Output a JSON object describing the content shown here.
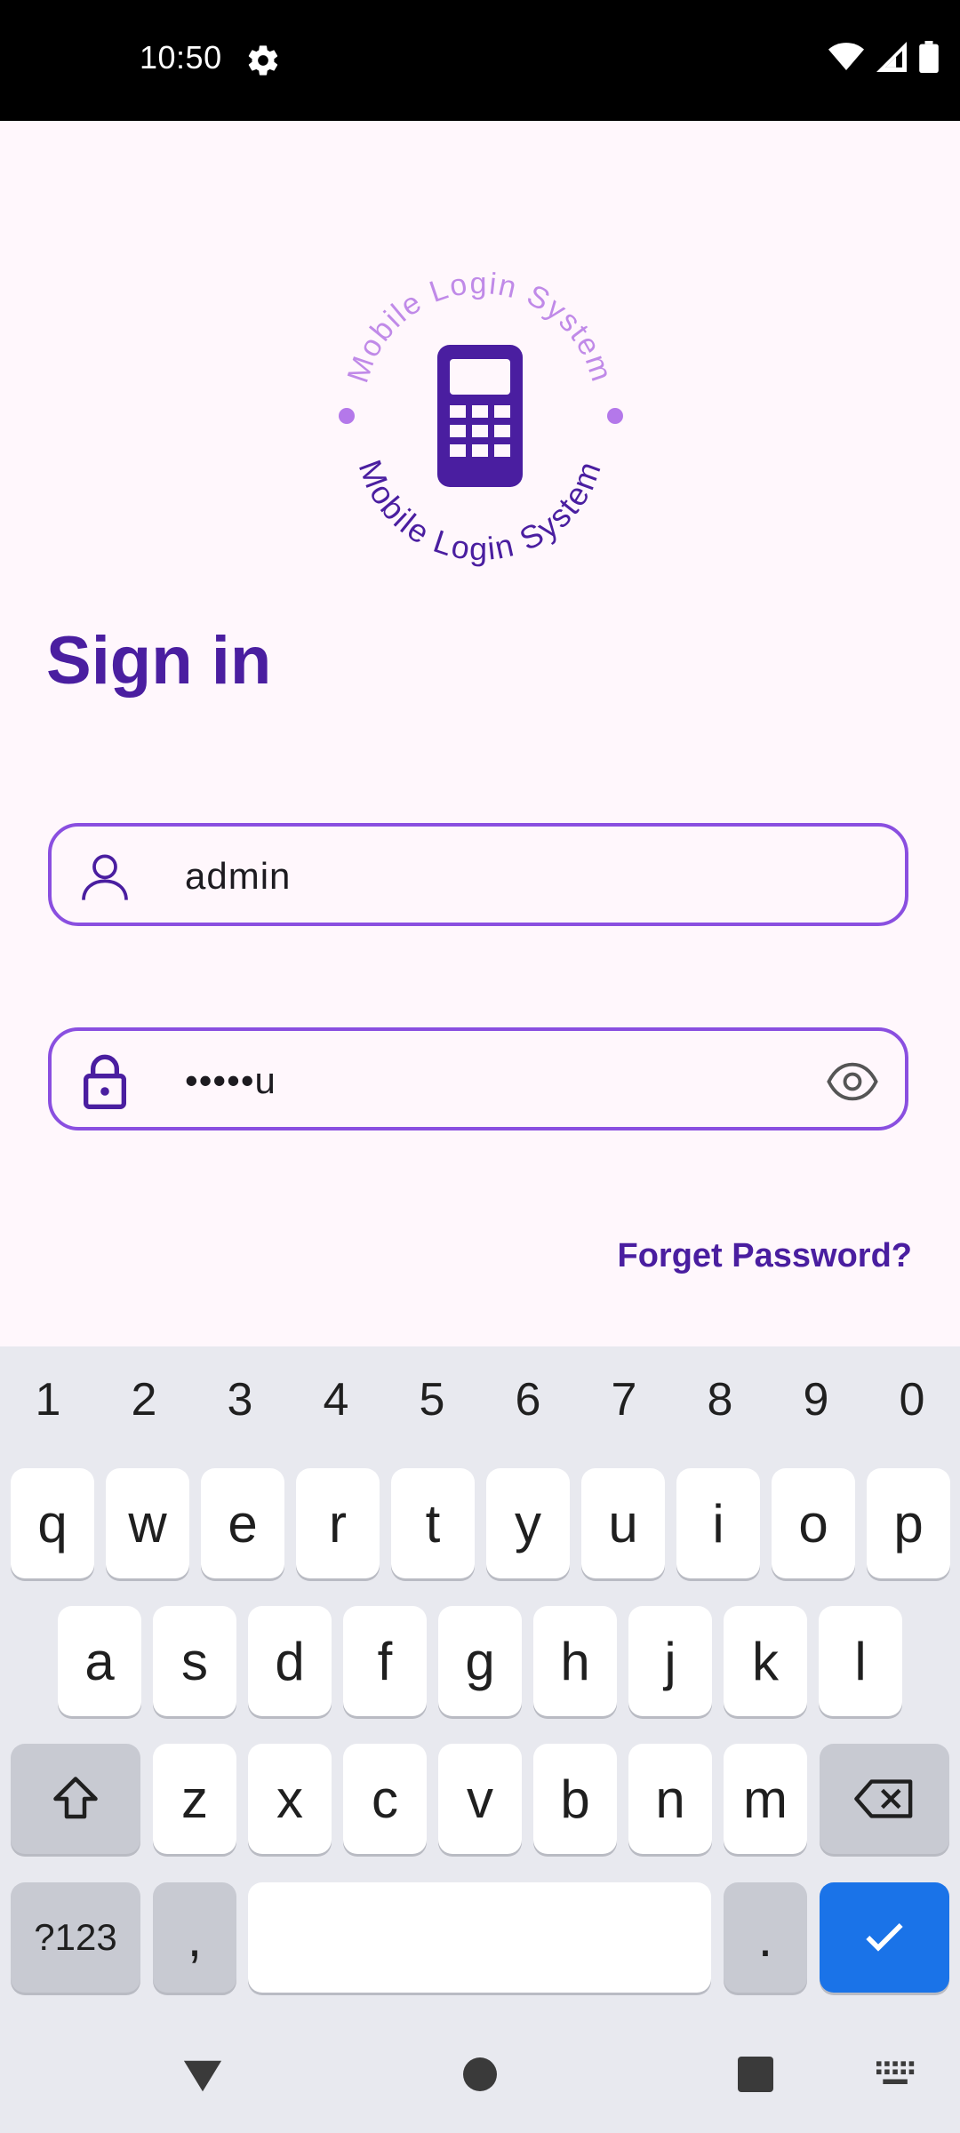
{
  "status_bar": {
    "time": "10:50"
  },
  "logo": {
    "top_text": "Mobile Login System",
    "bottom_text": "Mobile Login System"
  },
  "title": "Sign in",
  "username": {
    "value": "admin"
  },
  "password": {
    "value": "•••••u"
  },
  "forget_label": "Forget Password?",
  "keyboard": {
    "numbers": [
      "1",
      "2",
      "3",
      "4",
      "5",
      "6",
      "7",
      "8",
      "9",
      "0"
    ],
    "row1": [
      "q",
      "w",
      "e",
      "r",
      "t",
      "y",
      "u",
      "i",
      "o",
      "p"
    ],
    "row2": [
      "a",
      "s",
      "d",
      "f",
      "g",
      "h",
      "j",
      "k",
      "l"
    ],
    "row3": [
      "z",
      "x",
      "c",
      "v",
      "b",
      "n",
      "m"
    ],
    "symbols_label": "?123",
    "comma": ",",
    "period": "."
  },
  "colors": {
    "accent": "#4a1ea0",
    "border": "#8a4fe0",
    "action": "#1a73e8"
  }
}
